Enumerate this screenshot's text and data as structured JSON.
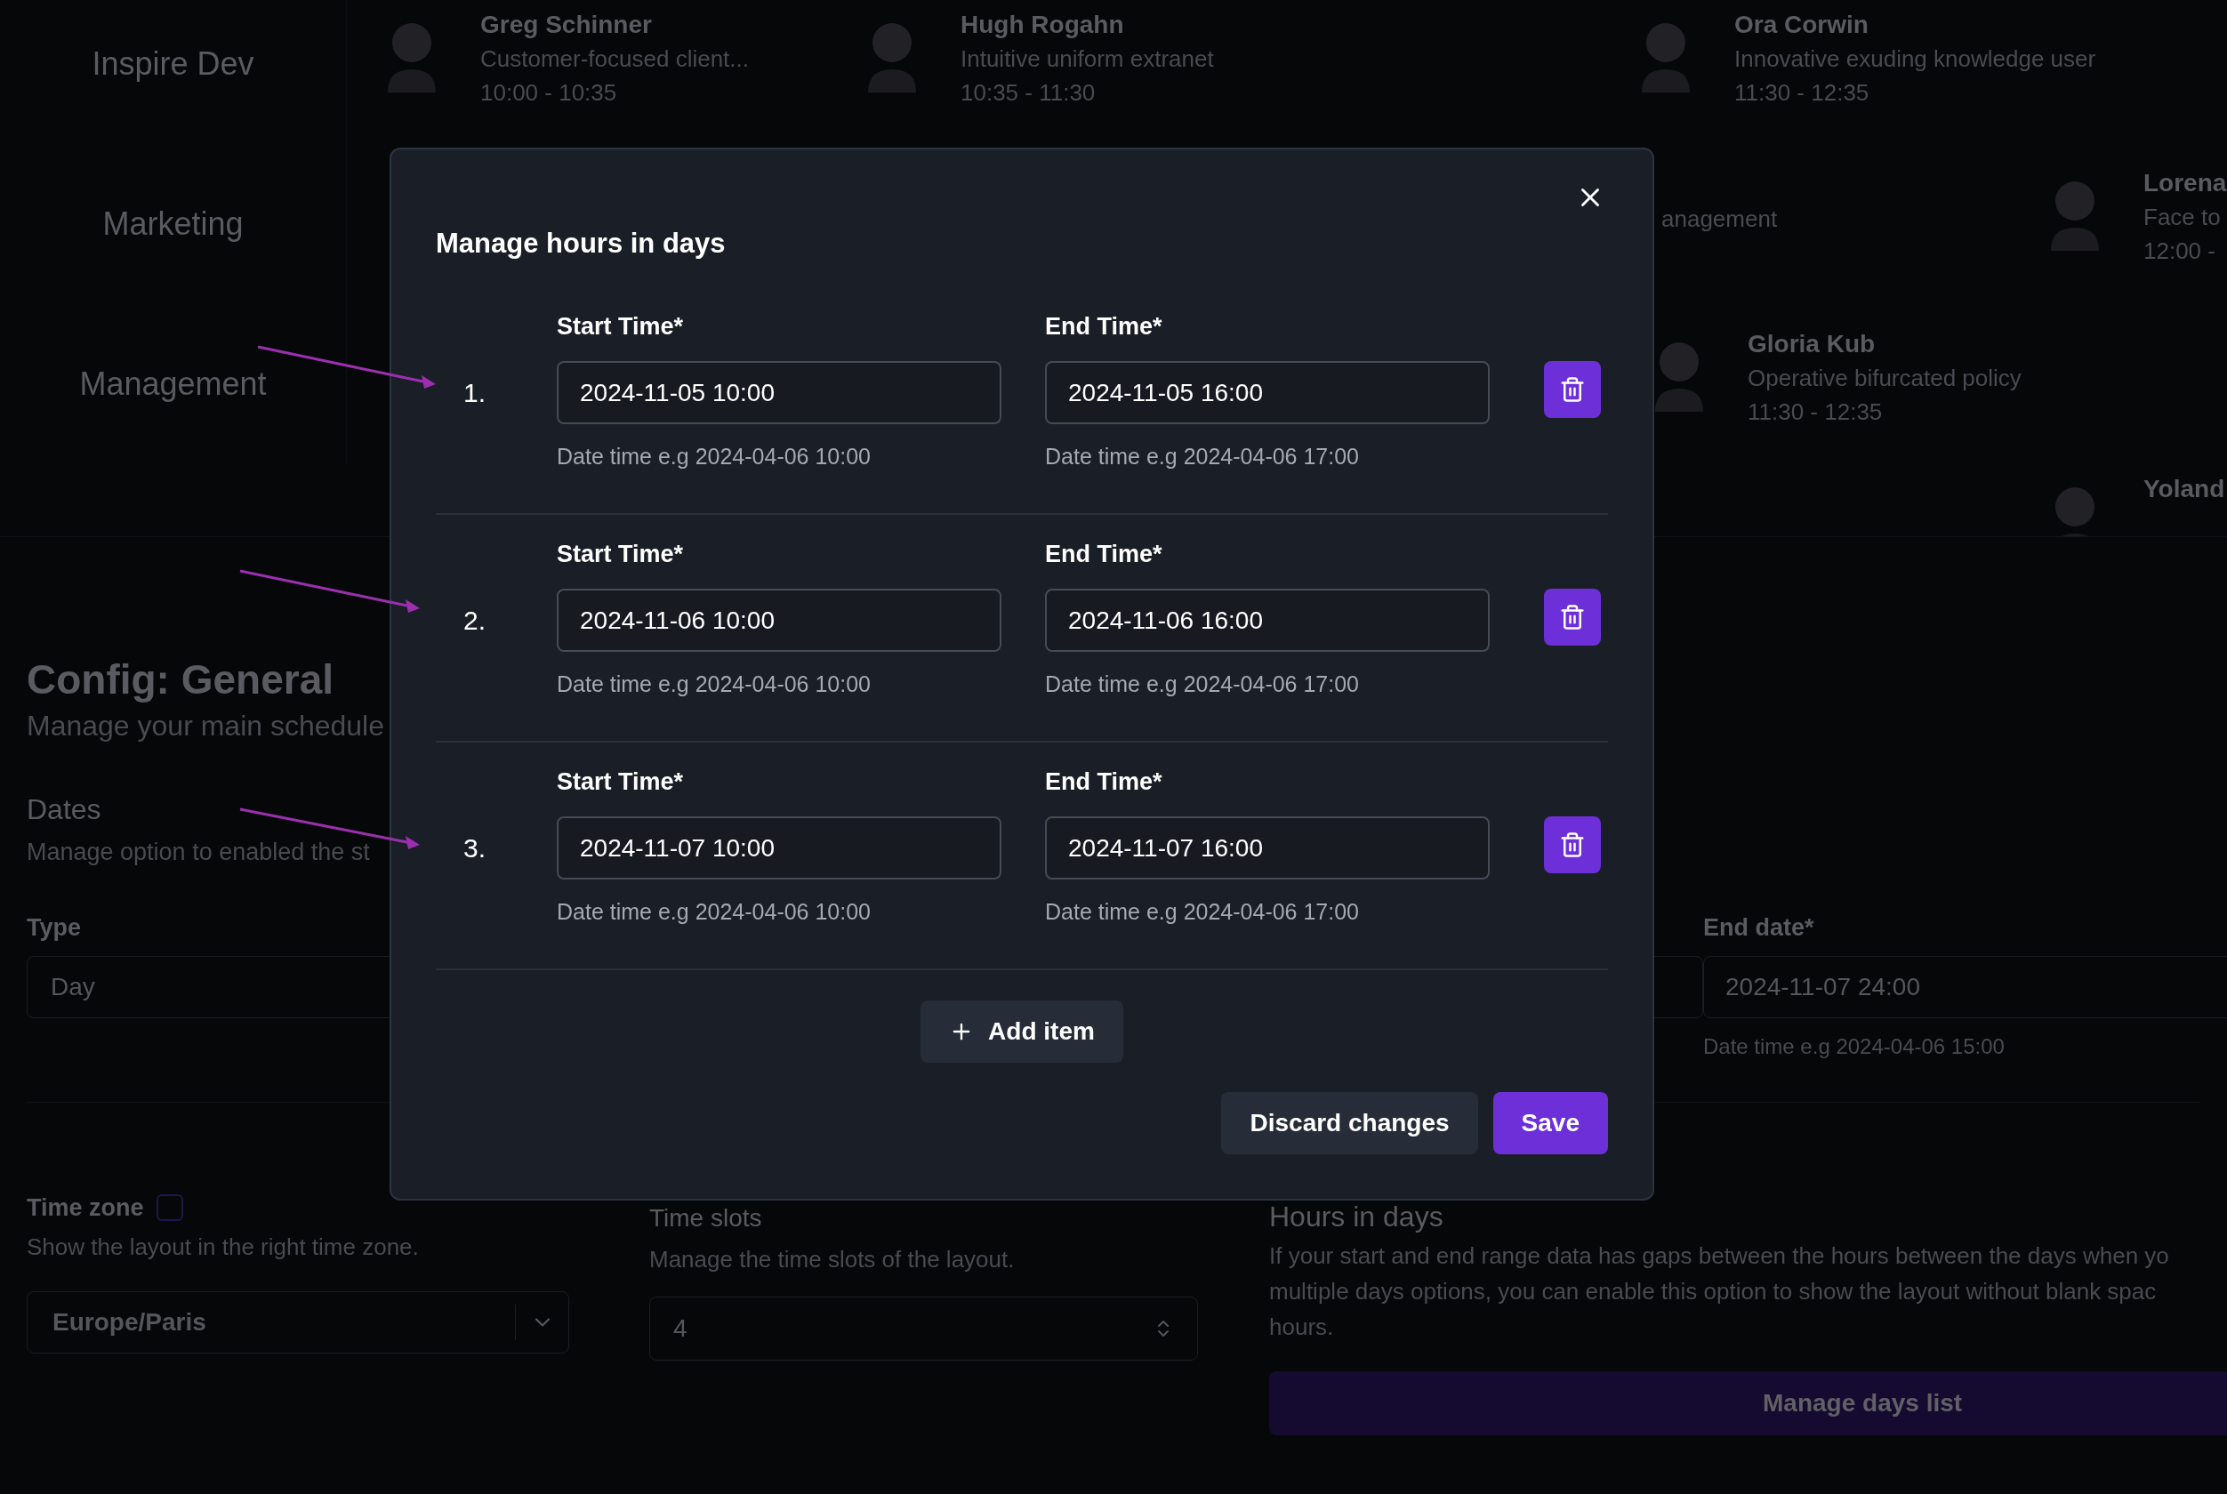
{
  "scheduler": {
    "rows": [
      {
        "label": "Inspire Dev",
        "events": [
          {
            "name": "Greg Schinner",
            "description": "Customer-focused client...",
            "time": "10:00 - 10:35"
          },
          {
            "name": "Hugh Rogahn",
            "description": "Intuitive uniform extranet",
            "time": "10:35 - 11:30"
          },
          {
            "name": "Ora Corwin",
            "description": "Innovative exuding knowledge user",
            "time": "11:30 - 12:35"
          }
        ]
      },
      {
        "label": "Marketing",
        "events": [
          {
            "description": "anagement"
          },
          {
            "name": "Lorena",
            "description": "Face to",
            "time": "12:00 -"
          }
        ]
      },
      {
        "label": "Management",
        "events": [
          {
            "name": "Gloria Kub",
            "description": "Operative bifurcated policy",
            "time": "11:30 - 12:35"
          },
          {
            "name": "Yoland"
          }
        ]
      }
    ]
  },
  "config": {
    "title": "Config: General",
    "subtitle": "Manage your main schedule",
    "dates": {
      "title": "Dates",
      "description": "Manage option to enabled the st",
      "type_label": "Type",
      "type_value": "Day",
      "end_label": "End date*",
      "end_value": "2024-11-07 24:00",
      "end_hint": "Date time e.g 2024-04-06 15:00"
    },
    "time_zone": {
      "label": "Time zone",
      "checked": false,
      "description": "Show the layout in the right time zone.",
      "value": "Europe/Paris"
    },
    "time_slots": {
      "title": "Time slots",
      "description": "Manage the time slots of the layout.",
      "value": "4"
    },
    "hours_in_days": {
      "title": "Hours in days",
      "description_lines": [
        "If your start and end range data has gaps between the hours between the days when yo",
        "multiple days options, you can enable this option to show the layout without blank spac",
        "hours."
      ],
      "button": "Manage days list"
    }
  },
  "modal": {
    "title": "Manage hours in days",
    "items": [
      {
        "number": "1.",
        "start_label": "Start Time*",
        "start_value": "2024-11-05 10:00",
        "start_hint": "Date time e.g 2024-04-06 10:00",
        "end_label": "End Time*",
        "end_value": "2024-11-05 16:00",
        "end_hint": "Date time e.g 2024-04-06 17:00"
      },
      {
        "number": "2.",
        "start_label": "Start Time*",
        "start_value": "2024-11-06 10:00",
        "start_hint": "Date time e.g 2024-04-06 10:00",
        "end_label": "End Time*",
        "end_value": "2024-11-06 16:00",
        "end_hint": "Date time e.g 2024-04-06 17:00"
      },
      {
        "number": "3.",
        "start_label": "Start Time*",
        "start_value": "2024-11-07 10:00",
        "start_hint": "Date time e.g 2024-04-06 10:00",
        "end_label": "End Time*",
        "end_value": "2024-11-07 16:00",
        "end_hint": "Date time e.g 2024-04-06 17:00"
      }
    ],
    "add_button": "Add item",
    "discard_button": "Discard changes",
    "save_button": "Save"
  }
}
